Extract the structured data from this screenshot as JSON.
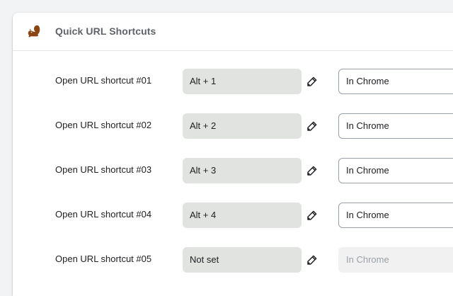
{
  "header": {
    "title": "Quick URL Shortcuts",
    "logo_icon": "squirrel-icon",
    "logo_color": "#8b4513"
  },
  "rows": [
    {
      "label": "Open URL shortcut #01",
      "shortcut": "Alt + 1",
      "mode": "In Chrome",
      "mode_enabled": true
    },
    {
      "label": "Open URL shortcut #02",
      "shortcut": "Alt + 2",
      "mode": "In Chrome",
      "mode_enabled": true
    },
    {
      "label": "Open URL shortcut #03",
      "shortcut": "Alt + 3",
      "mode": "In Chrome",
      "mode_enabled": true
    },
    {
      "label": "Open URL shortcut #04",
      "shortcut": "Alt + 4",
      "mode": "In Chrome",
      "mode_enabled": true
    },
    {
      "label": "Open URL shortcut #05",
      "shortcut": "Not set",
      "mode": "In Chrome",
      "mode_enabled": false
    }
  ],
  "edit_icon": "pencil-icon"
}
